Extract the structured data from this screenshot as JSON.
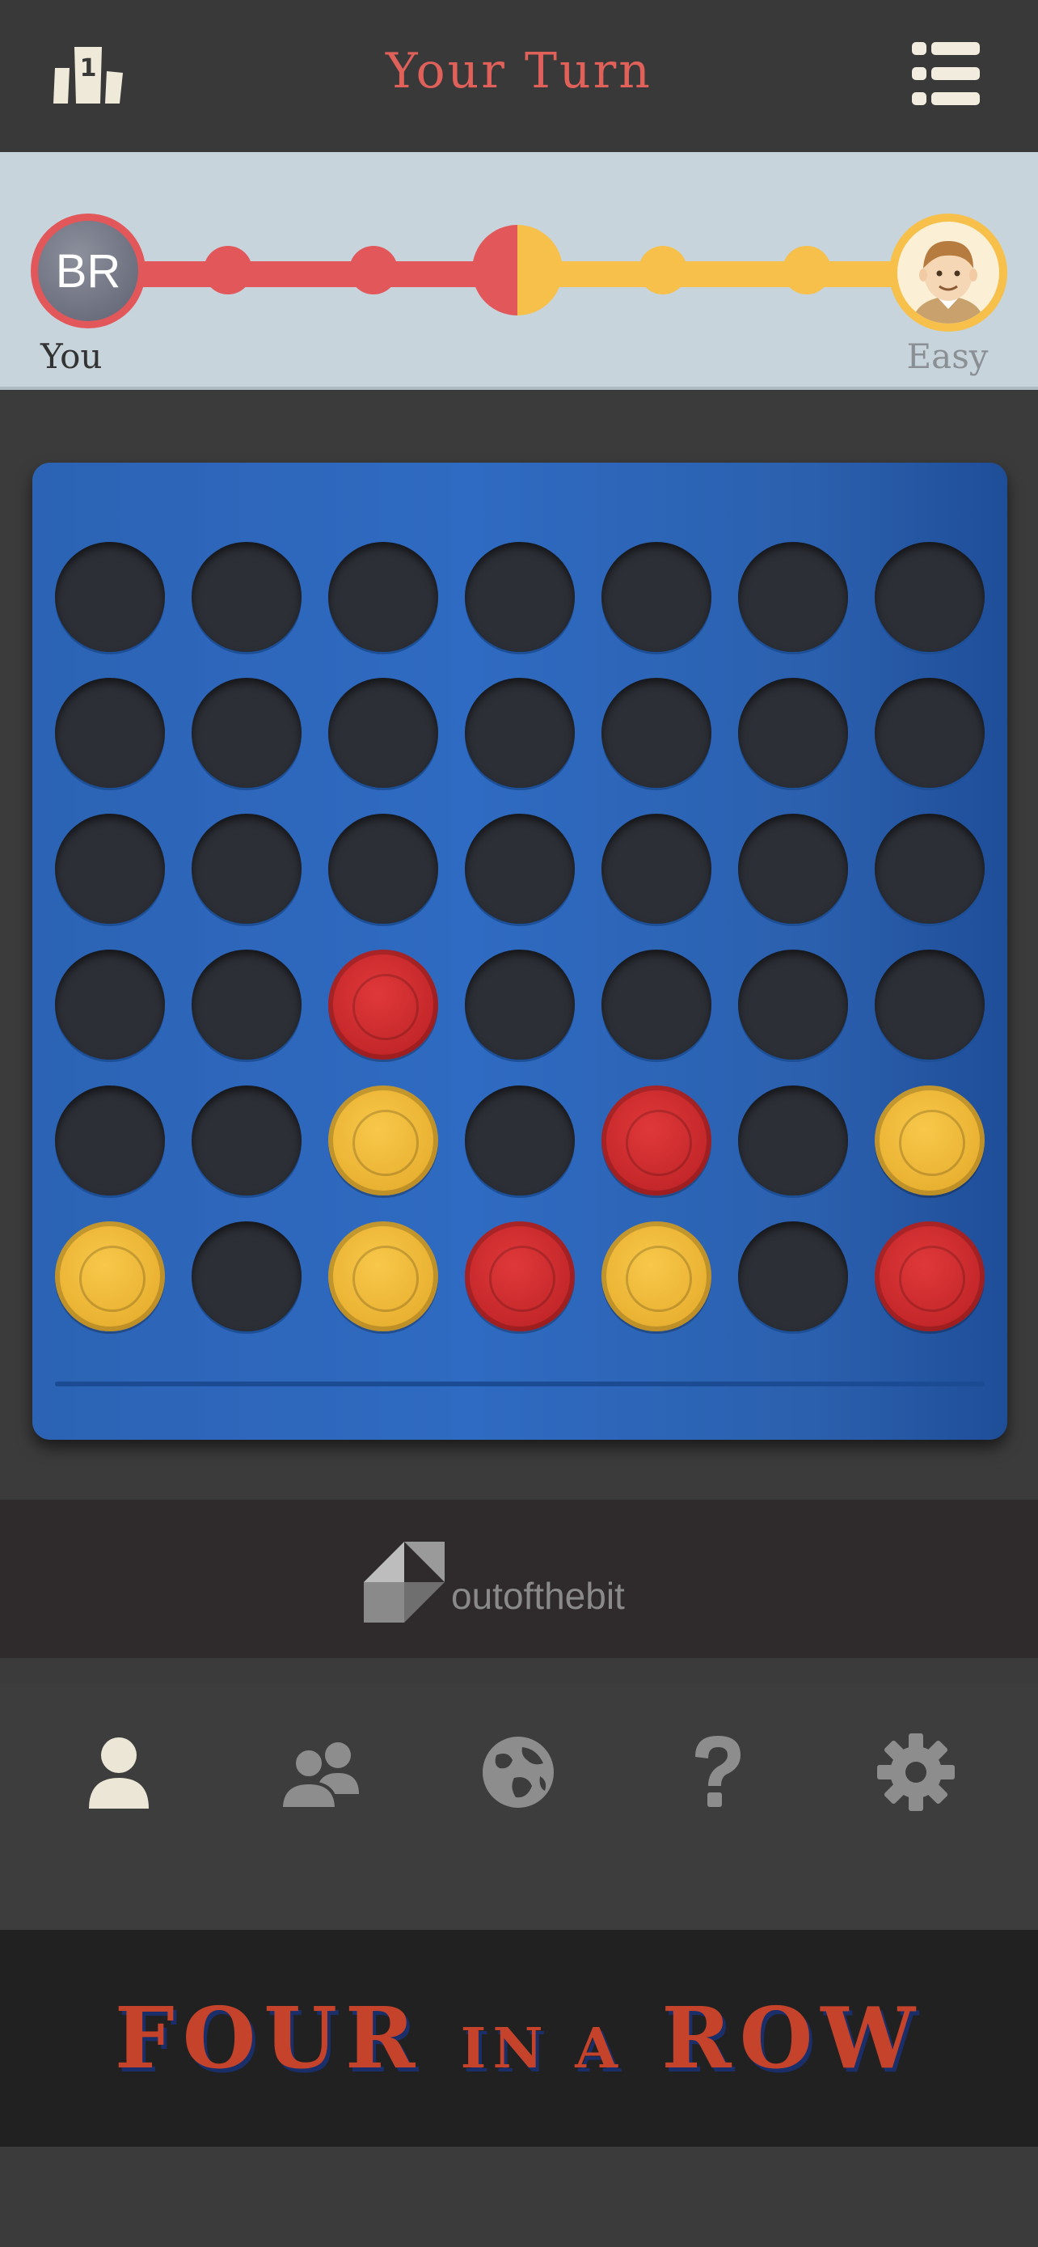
{
  "header": {
    "title": "Your Turn",
    "leaderboard_icon": "leaderboard-icon",
    "menu_icon": "list-menu-icon"
  },
  "players": {
    "you": {
      "initials": "BR",
      "label": "You",
      "color": "#e2585a"
    },
    "opponent": {
      "label": "Easy",
      "color": "#f6c04a",
      "icon": "cartoon-face-avatar-icon"
    }
  },
  "board": {
    "rows": 6,
    "cols": 7,
    "cells": [
      [
        "",
        "",
        "",
        "",
        "",
        "",
        ""
      ],
      [
        "",
        "",
        "",
        "",
        "",
        "",
        ""
      ],
      [
        "",
        "",
        "",
        "",
        "",
        "",
        ""
      ],
      [
        "",
        "",
        "R",
        "",
        "",
        "",
        ""
      ],
      [
        "",
        "",
        "Y",
        "",
        "R",
        "",
        "Y"
      ],
      [
        "Y",
        "",
        "Y",
        "R",
        "Y",
        "",
        "R"
      ]
    ],
    "colors": {
      "R": "#c82a2d",
      "Y": "#efb838",
      "board": "#2c63b4"
    }
  },
  "ad": {
    "text": "outofthebit"
  },
  "nav": {
    "items": [
      {
        "name": "single-player",
        "icon": "person-icon",
        "active": true
      },
      {
        "name": "two-player",
        "icon": "people-icon",
        "active": false
      },
      {
        "name": "online",
        "icon": "globe-icon",
        "active": false
      },
      {
        "name": "help",
        "icon": "question-mark-icon",
        "active": false
      },
      {
        "name": "settings",
        "icon": "gear-icon",
        "active": false
      }
    ]
  },
  "logo": {
    "word1": "FOUR",
    "word2": "IN A",
    "word3": "ROW"
  }
}
